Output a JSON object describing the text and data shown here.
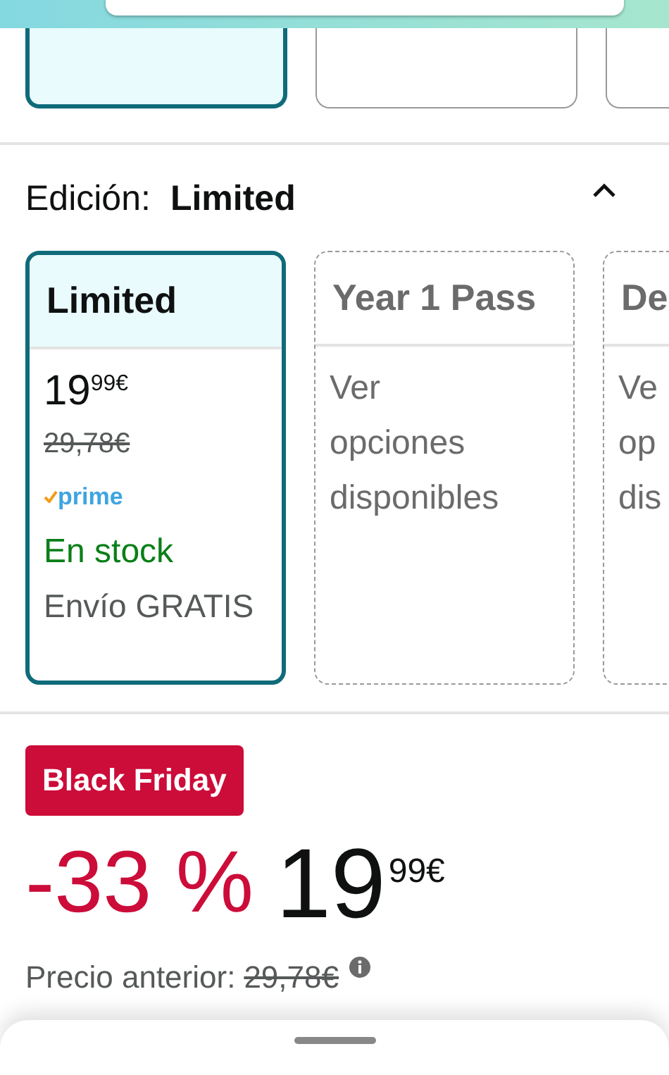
{
  "top_options": [
    {
      "selected": true
    },
    {
      "selected": false
    },
    {
      "selected": false
    }
  ],
  "edition": {
    "label": "Edición:",
    "value": "Limited",
    "expanded": true
  },
  "editions": [
    {
      "kind": "offer",
      "title": "Limited",
      "selected": true,
      "price_whole": "19",
      "price_fraction": "99",
      "currency": "€",
      "old_price": "29,78€",
      "prime": "prime",
      "stock": "En stock",
      "shipping": "Envío GRATIS"
    },
    {
      "kind": "unavailable",
      "title": "Year 1 Pass",
      "selected": false,
      "lines": [
        "Ver",
        "opciones",
        "disponibles"
      ]
    },
    {
      "kind": "unavailable",
      "title": "De",
      "selected": false,
      "lines": [
        "Ve",
        "op",
        "dis"
      ]
    }
  ],
  "deal": {
    "badge": "Black Friday",
    "discount": "-33 %",
    "price_whole": "19",
    "price_fraction": "99",
    "currency": "€",
    "previous_label": "Precio anterior:",
    "previous_price": "29,78€"
  }
}
